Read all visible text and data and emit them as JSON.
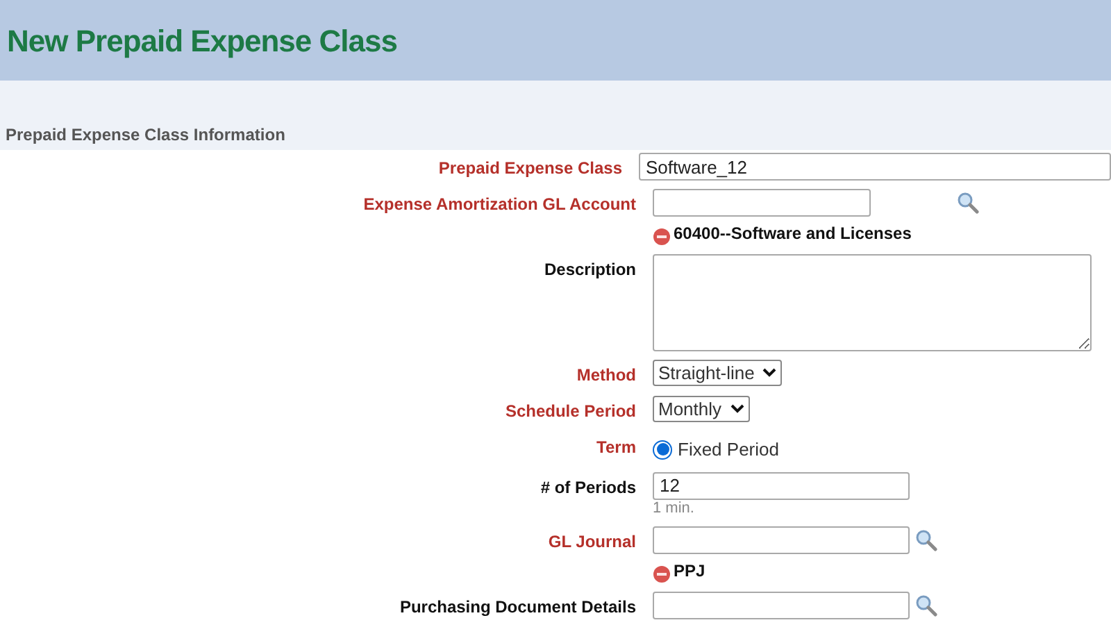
{
  "header": {
    "title": "New Prepaid Expense Class"
  },
  "section": {
    "title": "Prepaid Expense Class Information"
  },
  "fields": [
    {
      "kind": "text",
      "label": "Prepaid Expense Class",
      "required": true,
      "value": "Software_12"
    },
    {
      "kind": "lookup",
      "label": "Expense Amortization GL Account",
      "required": true,
      "display": "60400--Software and Licenses"
    },
    {
      "kind": "textarea",
      "label": "Description",
      "required": false
    },
    {
      "kind": "select",
      "label": "Method",
      "required": true,
      "value": "Straight-line"
    },
    {
      "kind": "select",
      "label": "Schedule Period",
      "required": true,
      "value": "Monthly"
    },
    {
      "kind": "radio",
      "label": "Term",
      "required": true,
      "options": [
        {
          "label": "Fixed Period",
          "selected": true
        }
      ]
    },
    {
      "kind": "text",
      "label": "# of Periods",
      "required": false,
      "value": "12",
      "hint": "1 min."
    },
    {
      "kind": "lookup",
      "label": "GL Journal",
      "required": true,
      "display": "PPJ"
    },
    {
      "kind": "lookup",
      "label": "Purchasing Document Details",
      "required": false
    }
  ]
}
